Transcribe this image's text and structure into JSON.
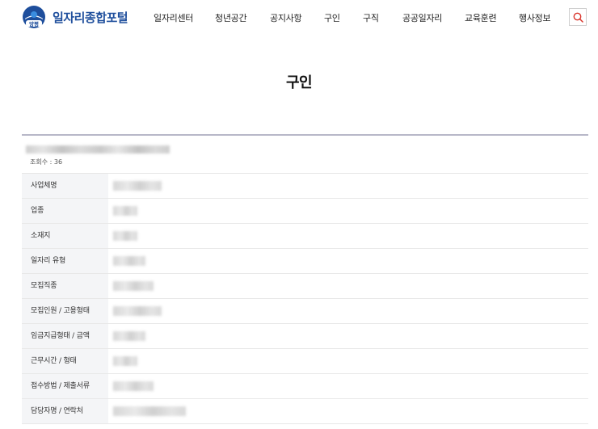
{
  "header": {
    "logo_text": "일자리종합포털",
    "logo_emblem_text": "양평",
    "nav": [
      {
        "label": "일자리센터"
      },
      {
        "label": "청년공간"
      },
      {
        "label": "공지사항"
      },
      {
        "label": "구인"
      },
      {
        "label": "구직"
      },
      {
        "label": "공공일자리"
      },
      {
        "label": "교육훈련"
      },
      {
        "label": "행사정보"
      }
    ],
    "search_icon": "search-icon"
  },
  "page": {
    "title": "구인",
    "views": "조회수 : 36"
  },
  "details": [
    {
      "label": "사업체명"
    },
    {
      "label": "업종"
    },
    {
      "label": "소재지"
    },
    {
      "label": "일자리 유형"
    },
    {
      "label": "모집직종"
    },
    {
      "label": "모집인원 / 고용형태"
    },
    {
      "label": "임금지급형태 / 금액"
    },
    {
      "label": "근무시간 / 형태"
    },
    {
      "label": "접수방법 / 제출서류"
    },
    {
      "label": "담당자명 / 연락처"
    }
  ],
  "colors": {
    "brand": "#1e4e9c",
    "search_accent": "#d9342b",
    "label_bg": "#f4f5f7",
    "title_rule": "#b8b8c8"
  }
}
